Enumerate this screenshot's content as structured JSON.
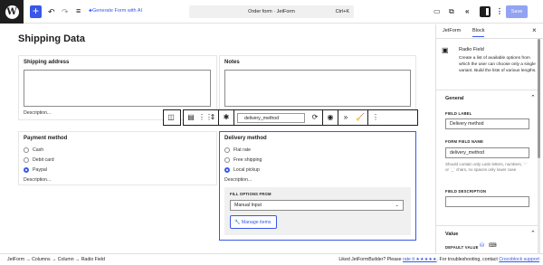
{
  "toolbar": {
    "ai_label": "Generate Form with AI",
    "doc_title": "Order form · JetForm",
    "shortcut": "Ctrl+K",
    "save_label": "Save",
    "icons": [
      "wordpress-logo-icon",
      "add-block-icon",
      "undo-icon",
      "redo-icon",
      "document-overview-icon",
      "jetform-ai-icon",
      "desktop-view-icon",
      "external-link-icon",
      "jetform-panel-icon",
      "settings-sidebar-icon",
      "more-options-icon"
    ]
  },
  "canvas": {
    "heading": "Shipping Data",
    "shipping_address": {
      "label": "Shipping address",
      "description": "Description..."
    },
    "notes": {
      "label": "Notes"
    },
    "payment": {
      "label": "Payment method",
      "options": [
        "Cash",
        "Debit card",
        "Paypal"
      ],
      "selected_index": 2,
      "description": "Description..."
    },
    "delivery": {
      "label": "Delivery method",
      "options": [
        "Flat rate",
        "Free shipping",
        "Local pickup"
      ],
      "selected_index": 2,
      "description": "Description...",
      "fill_options_label": "FILL OPTIONS FROM",
      "fill_options_value": "Manual Input",
      "manage_items_label": "Manage items"
    }
  },
  "block_toolbar": {
    "field_name": "delivery_method",
    "icons": [
      "parent-block-icon",
      "columns-icon",
      "drag-handle-icon",
      "move-arrows-icon",
      "required-asterisk-icon",
      "field-settings-icon",
      "visibility-icon",
      "forward-icon",
      "clear-icon",
      "more-options-icon"
    ]
  },
  "sidebar": {
    "tabs": [
      "JetForm",
      "Block"
    ],
    "active_tab": "Block",
    "block_title": "Radio Field",
    "block_desc": "Create a list of available options from which the user can choose only a single variant. Build the lists of various lengths.",
    "general_title": "General",
    "field_label_title": "FIELD LABEL",
    "field_label_value": "Delivery method",
    "form_field_name_title": "FORM FIELD NAME",
    "form_field_name_value": "delivery_method",
    "name_hint": "Should contain only Latin letters, numbers, `-` or `_` chars, no spaces only lower case",
    "field_description_title": "FIELD DESCRIPTION",
    "value_title": "Value",
    "default_value_title": "DEFAULT VALUE"
  },
  "breadcrumb": {
    "items": [
      "JetForm",
      "Columns",
      "Column",
      "Radio Field"
    ],
    "sep": "→"
  },
  "footer": {
    "liked_text": "Liked JetFormBuilder? Please",
    "rate_link": "rate it ★★★★★",
    "trouble_text": ". For troubleshooting, contact",
    "support_link": "Crocoblock support"
  },
  "colors": {
    "accent": "#3858e9",
    "dark": "#1e1e1e",
    "border": "#e0e0e0"
  }
}
